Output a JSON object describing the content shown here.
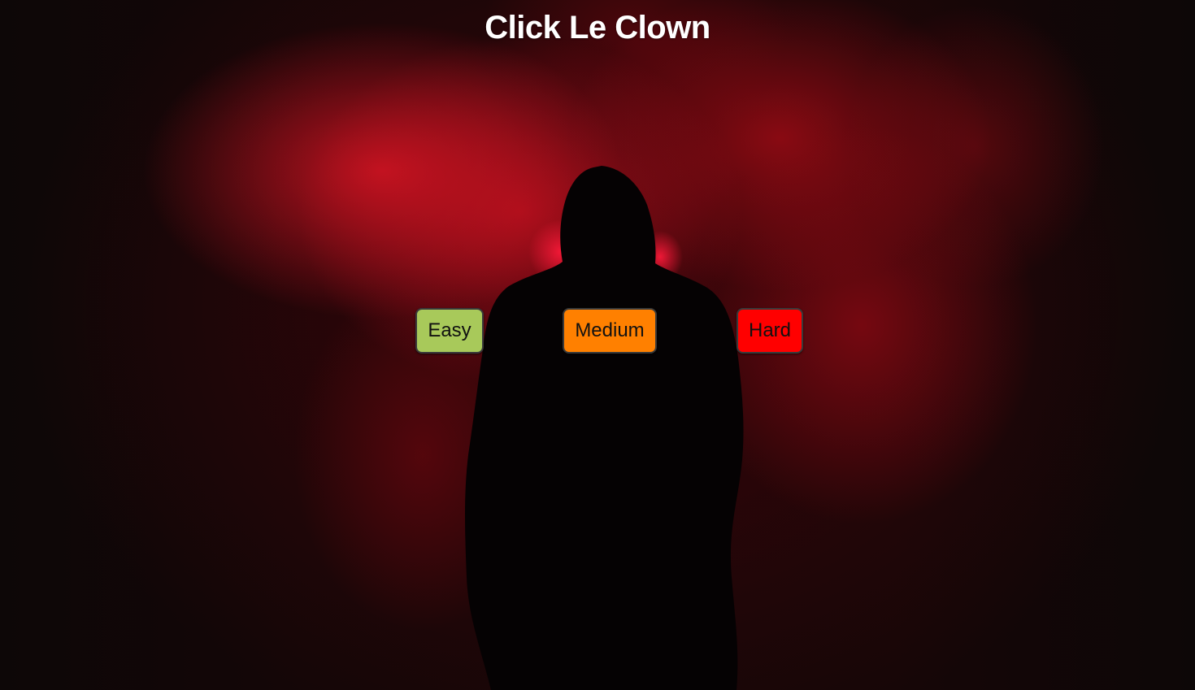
{
  "title": "Click Le Clown",
  "buttons": [
    {
      "id": "easy",
      "label": "Easy",
      "color": "#a8c95a"
    },
    {
      "id": "medium",
      "label": "Medium",
      "color": "#ff8000"
    },
    {
      "id": "hard",
      "label": "Hard",
      "color": "#ff0000"
    }
  ]
}
